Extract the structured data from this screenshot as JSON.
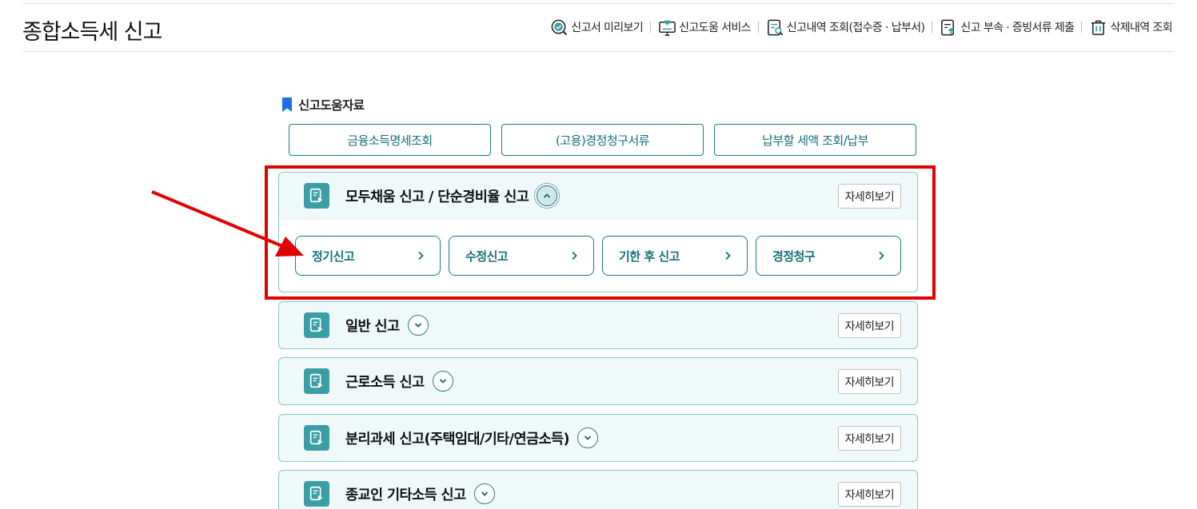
{
  "header": {
    "title": "종합소득세 신고",
    "links": [
      {
        "label": "신고서 미리보기",
        "icon": "check-search-icon"
      },
      {
        "label": "신고도움 서비스",
        "icon": "monitor-help-icon"
      },
      {
        "label": "신고내역 조회(접수증 · 납부서)",
        "icon": "document-search-icon"
      },
      {
        "label": "신고 부속 · 증빙서류 제출",
        "icon": "document-upload-icon"
      },
      {
        "label": "삭제내역 조회",
        "icon": "trash-icon"
      }
    ]
  },
  "help": {
    "label": "신고도움자료",
    "buttons": [
      "금융소득명세조회",
      "(고용)경정청구서류",
      "납부할 세액 조회/납부"
    ]
  },
  "accordions": [
    {
      "title": "모두채움 신고 / 단순경비율 신고",
      "detail": "자세히보기",
      "expanded": true,
      "sub": [
        "정기신고",
        "수정신고",
        "기한 후 신고",
        "경정청구"
      ]
    },
    {
      "title": "일반 신고",
      "detail": "자세히보기",
      "expanded": false
    },
    {
      "title": "근로소득 신고",
      "detail": "자세히보기",
      "expanded": false
    },
    {
      "title": "분리과세 신고(주택임대/기타/연금소득)",
      "detail": "자세히보기",
      "expanded": false
    },
    {
      "title": "종교인 기타소득 신고",
      "detail": "자세히보기",
      "expanded": false
    }
  ],
  "colors": {
    "accent": "#1a7c86",
    "icon_bg": "#3b9ea7",
    "panel_bg": "#eff9f9",
    "annotation": "#e10000"
  }
}
